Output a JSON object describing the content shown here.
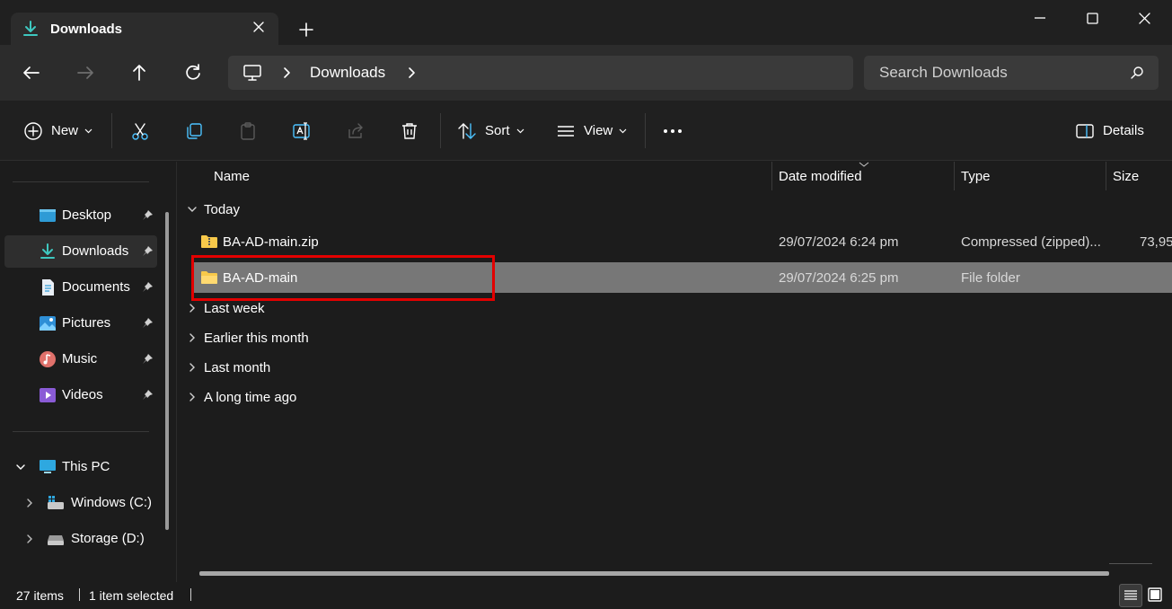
{
  "window": {
    "tab_title": "Downloads"
  },
  "address": {
    "breadcrumb": "Downloads",
    "search_placeholder": "Search Downloads"
  },
  "commands": {
    "new_label": "New",
    "sort_label": "Sort",
    "view_label": "View",
    "details_label": "Details"
  },
  "sidebar": {
    "quick_access": [
      {
        "label": "Desktop",
        "icon": "desktop-icon",
        "pinned": true
      },
      {
        "label": "Downloads",
        "icon": "download-icon",
        "pinned": true,
        "active": true
      },
      {
        "label": "Documents",
        "icon": "documents-icon",
        "pinned": true
      },
      {
        "label": "Pictures",
        "icon": "pictures-icon",
        "pinned": true
      },
      {
        "label": "Music",
        "icon": "music-icon",
        "pinned": true
      },
      {
        "label": "Videos",
        "icon": "videos-icon",
        "pinned": true
      }
    ],
    "this_pc": {
      "label": "This PC",
      "children": [
        {
          "label": "Windows (C:)",
          "icon": "windows-drive-icon"
        },
        {
          "label": "Storage (D:)",
          "icon": "drive-icon"
        }
      ]
    }
  },
  "columns": {
    "name": "Name",
    "date_modified": "Date modified",
    "type": "Type",
    "size": "Size"
  },
  "groups": {
    "today": "Today",
    "last_week": "Last week",
    "earlier_this_month": "Earlier this month",
    "last_month": "Last month",
    "long_time_ago": "A long time ago"
  },
  "files": [
    {
      "name": "BA-AD-main.zip",
      "date": "29/07/2024 6:24 pm",
      "type": "Compressed (zipped)...",
      "size": "73,95",
      "icon": "zip-folder-icon",
      "selected": false
    },
    {
      "name": "BA-AD-main",
      "date": "29/07/2024 6:25 pm",
      "type": "File folder",
      "size": "",
      "icon": "folder-icon",
      "selected": true
    }
  ],
  "status": {
    "item_count": "27 items",
    "selection": "1 item selected"
  },
  "colors": {
    "accent": "#4cc2ff",
    "folder": "#f8c94a",
    "highlight_box": "#e30000",
    "selected_row": "#777777"
  }
}
